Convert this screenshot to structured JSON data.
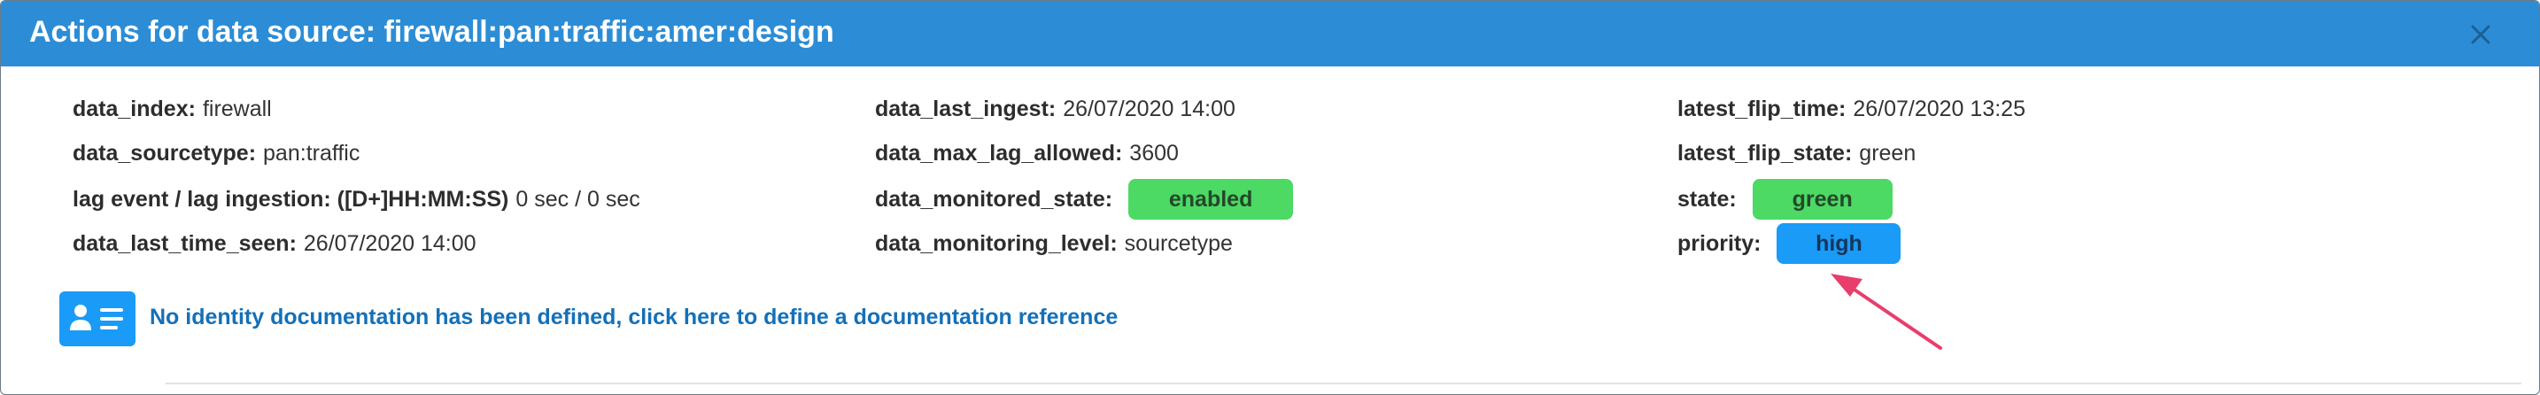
{
  "header": {
    "title": "Actions for data source: firewall:pan:traffic:amer:design"
  },
  "columns": {
    "left": {
      "data_index": {
        "label": "data_index:",
        "value": "firewall"
      },
      "data_sourcetype": {
        "label": "data_sourcetype:",
        "value": "pan:traffic"
      },
      "lag": {
        "label": "lag event / lag ingestion: ([D+]HH:MM:SS)",
        "value": "0 sec / 0 sec"
      },
      "data_last_time_seen": {
        "label": "data_last_time_seen:",
        "value": "26/07/2020 14:00"
      }
    },
    "middle": {
      "data_last_ingest": {
        "label": "data_last_ingest:",
        "value": "26/07/2020 14:00"
      },
      "data_max_lag_allowed": {
        "label": "data_max_lag_allowed:",
        "value": "3600"
      },
      "data_monitored_state": {
        "label": "data_monitored_state:",
        "value": "enabled"
      },
      "data_monitoring_level": {
        "label": "data_monitoring_level:",
        "value": "sourcetype"
      }
    },
    "right": {
      "latest_flip_time": {
        "label": "latest_flip_time:",
        "value": "26/07/2020 13:25"
      },
      "latest_flip_state": {
        "label": "latest_flip_state:",
        "value": "green"
      },
      "state": {
        "label": "state:",
        "value": "green"
      },
      "priority": {
        "label": "priority:",
        "value": "high"
      }
    }
  },
  "documentation": {
    "link_text": "No identity documentation has been defined, click here to define a documentation reference",
    "icon": "id-card-icon"
  },
  "colors": {
    "header_bg": "#2c8dd6",
    "badge_green": "#4cd964",
    "badge_blue": "#1a9bf7",
    "link": "#1470b8",
    "annotation_arrow": "#e83e6c"
  },
  "icons": {
    "close": "close-icon",
    "annotation": "arrow-annotation"
  }
}
